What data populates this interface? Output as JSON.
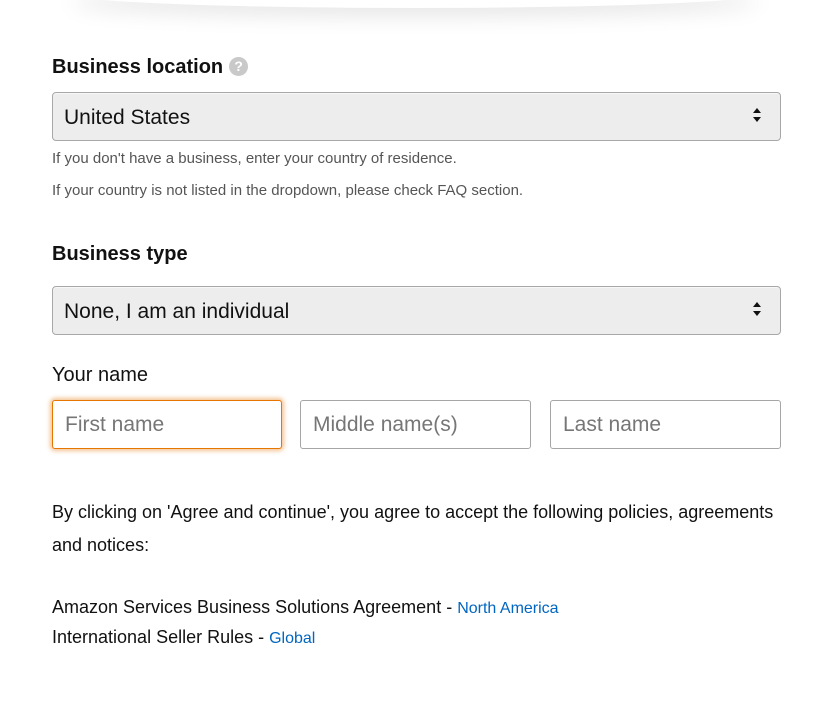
{
  "business_location": {
    "label": "Business location",
    "help_icon_text": "?",
    "selected": "United States",
    "hint_line1": "If you don't have a business, enter your country of residence.",
    "hint_line2": "If your country is not listed in the dropdown, please check FAQ section."
  },
  "business_type": {
    "label": "Business type",
    "selected": "None, I am an individual"
  },
  "your_name": {
    "label": "Your name",
    "first_placeholder": "First name",
    "first_value": "",
    "middle_placeholder": "Middle name(s)",
    "middle_value": "",
    "last_placeholder": "Last name",
    "last_value": ""
  },
  "agreement": {
    "text": "By clicking on 'Agree and continue', you agree to accept the following policies, agreements and notices:",
    "policies": [
      {
        "name": "Amazon Services Business Solutions Agreement - ",
        "link": "North America"
      },
      {
        "name": "International Seller Rules - ",
        "link": "Global"
      }
    ]
  },
  "colors": {
    "link": "#0066c0",
    "focus_border": "#e77600",
    "select_bg": "#ededed"
  }
}
